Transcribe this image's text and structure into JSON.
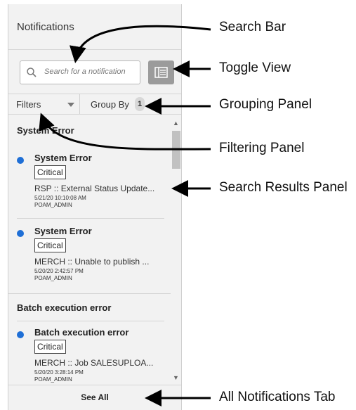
{
  "panel": {
    "title": "Notifications",
    "search": {
      "placeholder": "Search for a notification",
      "icon": "search-icon"
    },
    "toggle_view": {
      "icon": "list-view-icon"
    },
    "filters": {
      "label": "Filters",
      "caret": "chevron-down-icon"
    },
    "group_by": {
      "label": "Group By",
      "count": "1"
    },
    "groups": [
      {
        "header": "System Error",
        "items": [
          {
            "title": "System Error",
            "severity": "Critical",
            "message": "RSP :: External Status Update...",
            "timestamp": "5/21/20 10:10:08 AM",
            "user": "POAM_ADMIN"
          },
          {
            "title": "System Error",
            "severity": "Critical",
            "message": "MERCH :: Unable to publish ...",
            "timestamp": "5/20/20 2:42:57 PM",
            "user": "POAM_ADMIN"
          }
        ]
      },
      {
        "header": "Batch execution error",
        "items": [
          {
            "title": "Batch execution error",
            "severity": "Critical",
            "message": "MERCH :: Job SALESUPLOA...",
            "timestamp": "5/20/20 3:28:14 PM",
            "user": "POAM_ADMIN"
          }
        ]
      }
    ],
    "see_all": "See All"
  },
  "callouts": {
    "search_bar": "Search Bar",
    "toggle_view": "Toggle View",
    "grouping_panel": "Grouping Panel",
    "filtering_panel": "Filtering Panel",
    "search_results_panel": "Search Results Panel",
    "all_notifications_tab": "All Notifications Tab"
  },
  "colors": {
    "unread_dot": "#1f6fd6",
    "panel_bg": "#f2f2f2",
    "toggle_bg": "#9b9b9b"
  }
}
